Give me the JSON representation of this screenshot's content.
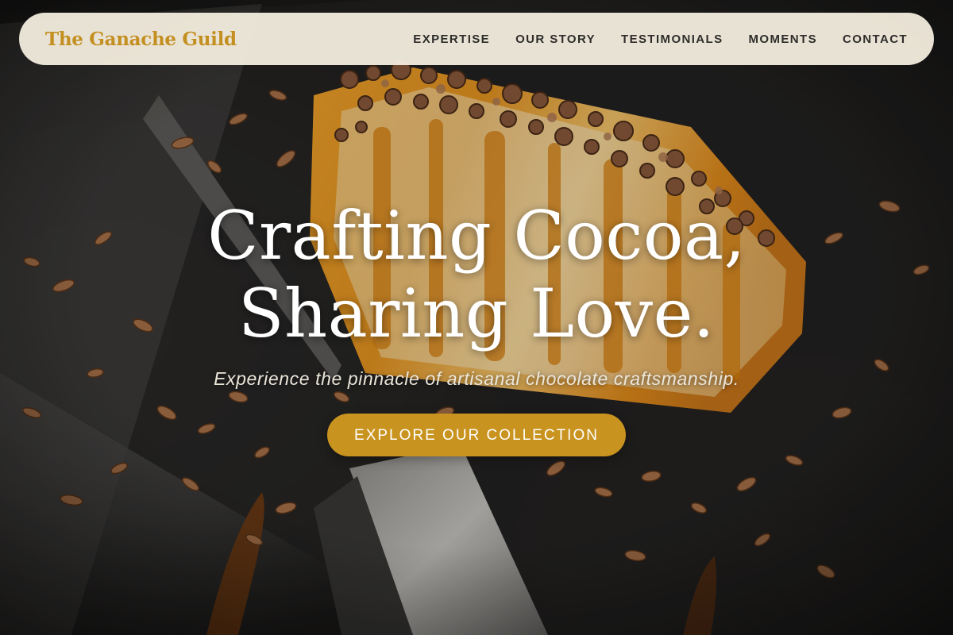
{
  "brand": {
    "name": "The Ganache Guild",
    "color": "#c48f21"
  },
  "nav": {
    "items": [
      {
        "label": "EXPERTISE"
      },
      {
        "label": "OUR STORY"
      },
      {
        "label": "TESTIMONIALS"
      },
      {
        "label": "MOMENTS"
      },
      {
        "label": "CONTACT"
      }
    ]
  },
  "hero": {
    "title_line1": "Crafting Cocoa,",
    "title_line2": "Sharing Love.",
    "subtitle": "Experience the pinnacle of artisanal chocolate craftsmanship.",
    "cta_label": "EXPLORE OUR COLLECTION",
    "background_image": "cheesecake-slice-with-chocolate-shavings"
  },
  "colors": {
    "accent": "#c9931f",
    "navbar_bg": "#f3edde",
    "nav_text": "#2e2d2b",
    "hero_text": "#ffffff"
  }
}
